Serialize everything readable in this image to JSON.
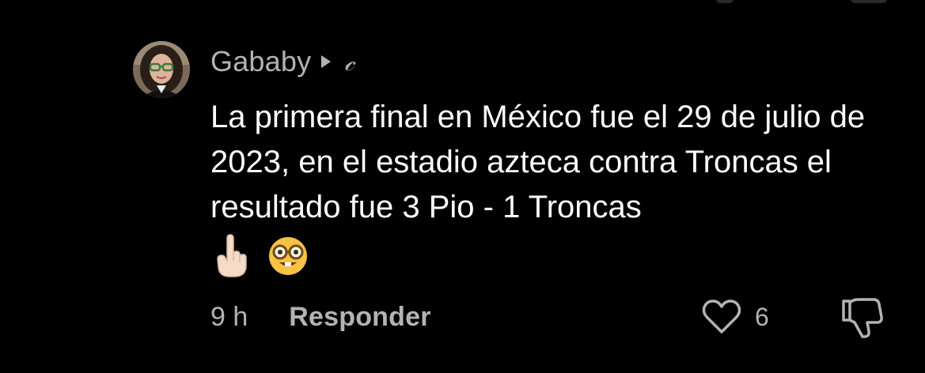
{
  "comment": {
    "username": "Gababy",
    "icons": {
      "avatar": "profile-photo",
      "play": "play-triangle-icon",
      "creator": "creator-badge-icon",
      "emoji_1": "point-up-emoji",
      "emoji_2": "nerd-face-emoji",
      "like": "heart-outline-icon",
      "dislike": "thumbs-down-outline-icon"
    },
    "creator_badge": "𝒸",
    "text": "La primera final en México fue el 29 de julio de 2023, en el estadio azteca contra Troncas el resultado fue 3 Pio - 1 Troncas",
    "time": "9 h",
    "reply_label": "Responder",
    "like_count": "6"
  },
  "colors": {
    "background": "#000000",
    "primary_text": "#ffffff",
    "secondary_text": "#b3b3b3"
  }
}
